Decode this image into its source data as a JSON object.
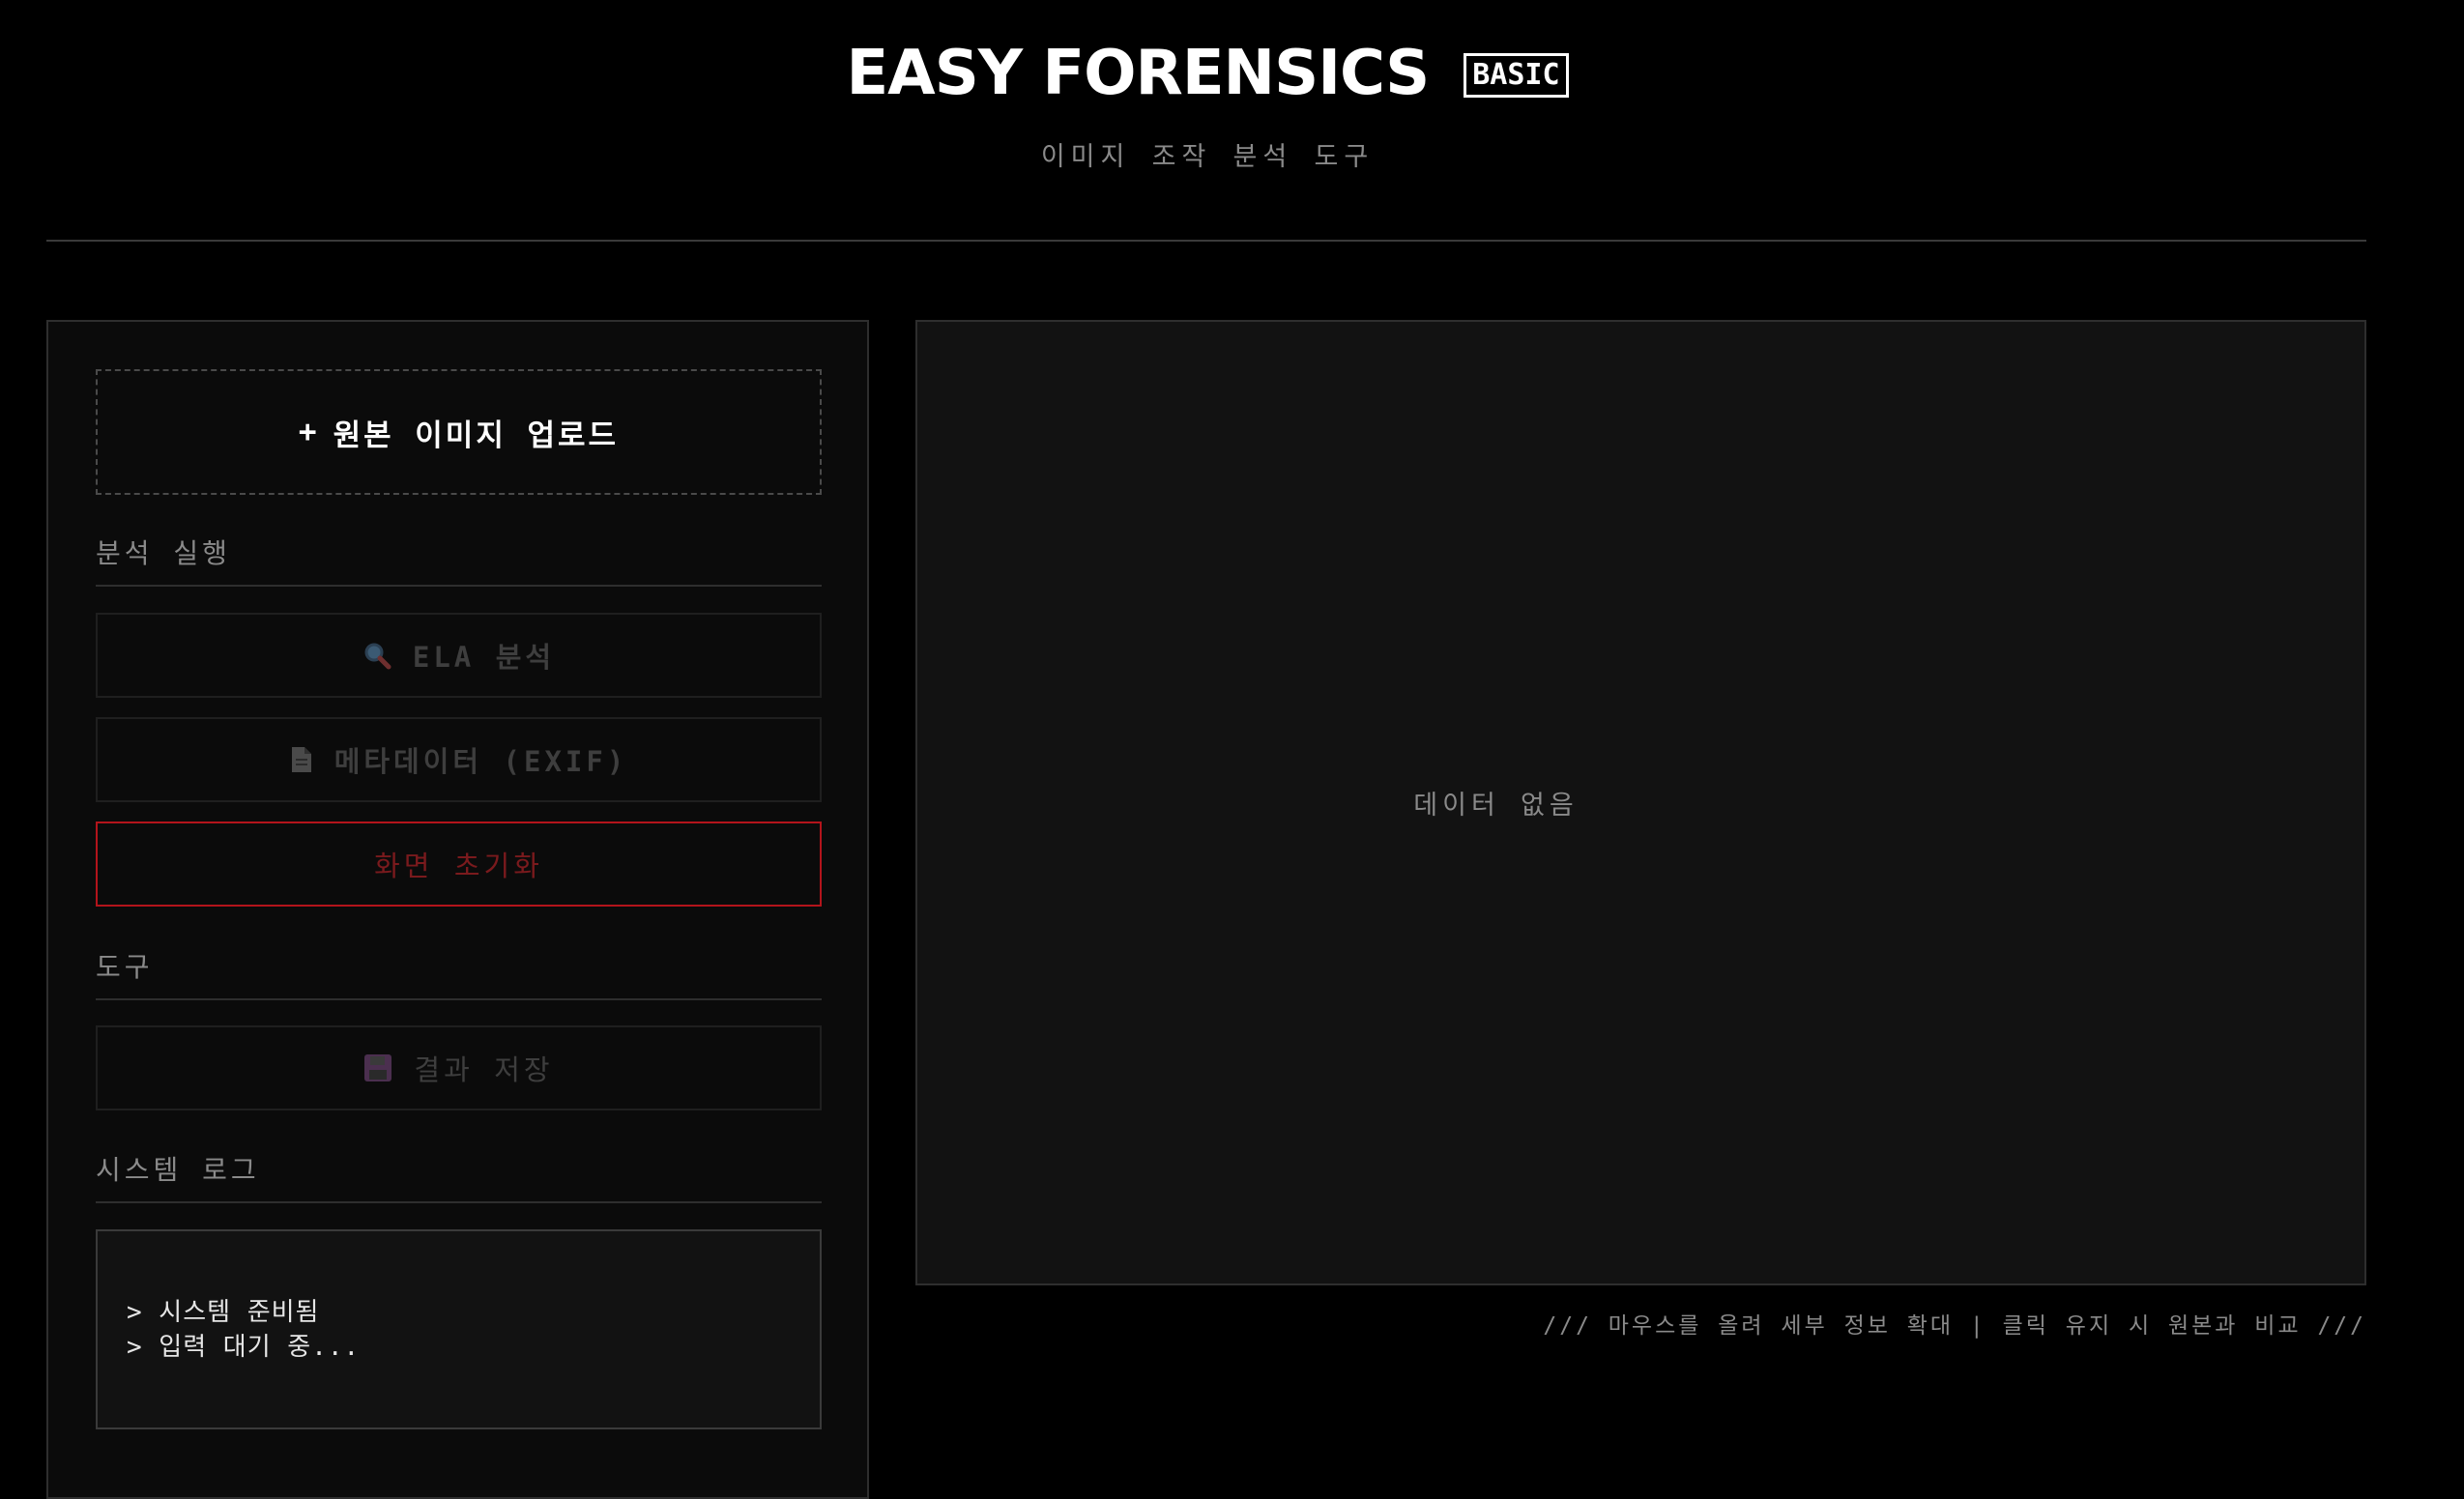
{
  "header": {
    "title": "EASY FORENSICS",
    "badge": "BASIC",
    "subtitle": "이미지 조작 분석 도구"
  },
  "sidebar": {
    "upload": {
      "icon": "plus",
      "label": "원본 이미지 업로드"
    },
    "analysis_section": {
      "label": "분석 실행",
      "ela_button": {
        "icon": "magnifier-icon",
        "label": "ELA 분석"
      },
      "exif_button": {
        "icon": "document-icon",
        "label": "메타데이터 (EXIF)"
      },
      "reset_button": {
        "label": "화면 초기화"
      }
    },
    "tools_section": {
      "label": "도구",
      "save_button": {
        "icon": "floppy-disk-icon",
        "label": "결과 저장"
      }
    },
    "log_section": {
      "label": "시스템 로그",
      "lines": [
        "> 시스템 준비됨",
        "> 입력 대기 중..."
      ]
    }
  },
  "viewer": {
    "empty_text": "데이터 없음",
    "hint": "/// 마우스를 올려 세부 정보 확대 | 클릭 유지 시 원본과 비교 ///"
  },
  "colors": {
    "background": "#000000",
    "panel": "#0b0b0b",
    "viewer": "#121212",
    "danger": "#b3141b"
  }
}
